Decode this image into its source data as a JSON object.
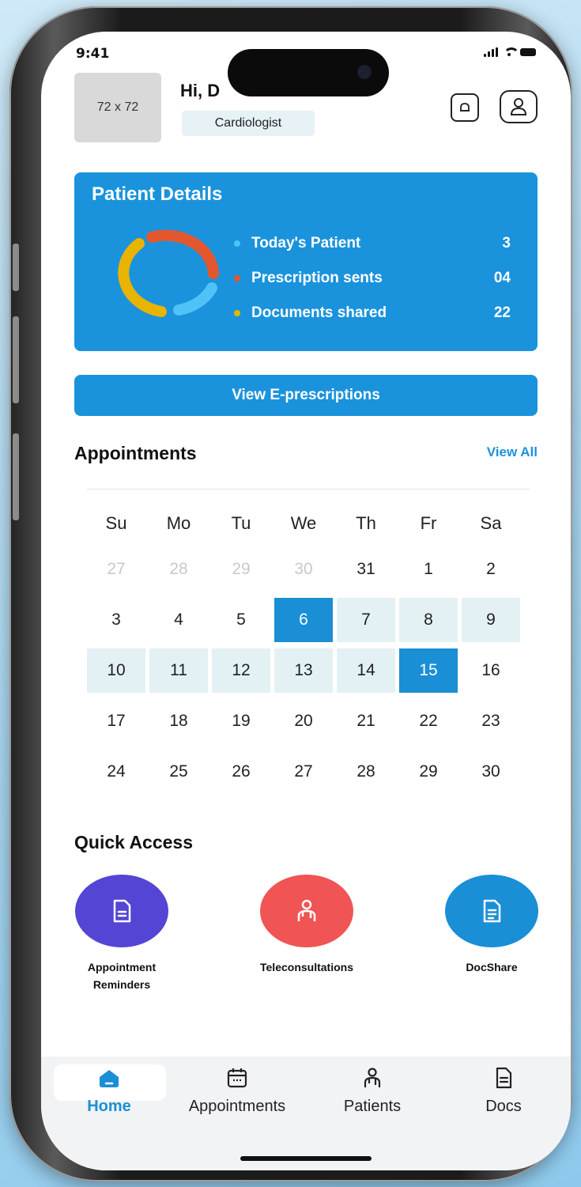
{
  "status_bar": {
    "time": "9:41"
  },
  "header": {
    "avatar_placeholder": "72 x 72",
    "greeting": "Hi, D",
    "specialty": "Cardiologist",
    "icons": [
      "bell-icon",
      "profile-icon"
    ]
  },
  "patient_card": {
    "title": "Patient Details",
    "stats": [
      {
        "label": "Today's Patient",
        "value": "3",
        "color": "#4fc3f7"
      },
      {
        "label": "Prescription sents",
        "value": "04",
        "color": "#e4572e"
      },
      {
        "label": "Documents shared",
        "value": "22",
        "color": "#e8b400"
      }
    ],
    "donut_colors": [
      "#e4572e",
      "#4fc3f7",
      "#e8b400"
    ]
  },
  "eprescriptions_button": "View E-prescriptions",
  "appointments": {
    "title": "Appointments",
    "view_all": "View All",
    "weekdays": [
      "Su",
      "Mo",
      "Tu",
      "We",
      "Th",
      "Fr",
      "Sa"
    ],
    "weeks": [
      [
        "27",
        "28",
        "29",
        "30",
        "31",
        "1",
        "2"
      ],
      [
        "3",
        "4",
        "5",
        "6",
        "7",
        "8",
        "9"
      ],
      [
        "10",
        "11",
        "12",
        "13",
        "14",
        "15",
        "16"
      ],
      [
        "17",
        "18",
        "19",
        "20",
        "21",
        "22",
        "23"
      ],
      [
        "24",
        "25",
        "26",
        "27",
        "28",
        "29",
        "30"
      ]
    ],
    "muted_days": [
      "27",
      "28",
      "29",
      "30"
    ],
    "selected_days": [
      "6",
      "15"
    ],
    "highlighted_range": [
      "7",
      "8",
      "9",
      "10",
      "11",
      "12",
      "13",
      "14"
    ],
    "accent_color": "#1a8fd6"
  },
  "quick_access": {
    "title": "Quick Access",
    "items": [
      {
        "label_line1": "Appointment",
        "label_line2": "Reminders",
        "color": "#5545d4",
        "icon": "document-icon"
      },
      {
        "label_line1": "Teleconsultations",
        "label_line2": "",
        "color": "#f05454",
        "icon": "doctor-icon"
      },
      {
        "label_line1": "DocShare",
        "label_line2": "",
        "color": "#1a8fd6",
        "icon": "file-icon"
      }
    ]
  },
  "tab_bar": {
    "tabs": [
      {
        "label": "Home",
        "icon": "home-icon",
        "active": true
      },
      {
        "label": "Appointments",
        "icon": "calendar-icon",
        "active": false
      },
      {
        "label": "Patients",
        "icon": "patients-icon",
        "active": false
      },
      {
        "label": "Docs",
        "icon": "docs-icon",
        "active": false
      }
    ]
  }
}
